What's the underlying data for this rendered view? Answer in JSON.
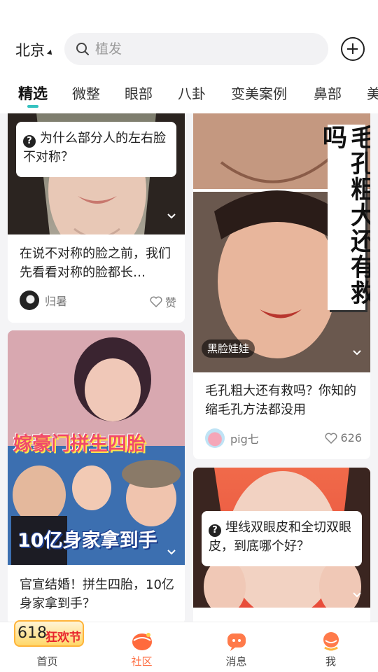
{
  "header": {
    "city": "北京",
    "search_placeholder": "植发",
    "add_icon": "plus-circle-icon"
  },
  "tabs": [
    {
      "label": "精选",
      "active": true
    },
    {
      "label": "微整"
    },
    {
      "label": "眼部"
    },
    {
      "label": "八卦"
    },
    {
      "label": "变美案例"
    },
    {
      "label": "鼻部"
    },
    {
      "label": "美"
    }
  ],
  "feed": {
    "left": [
      {
        "question": "为什么部分人的左右脸不对称？",
        "title": "在说不对称的脸之前，我们先看看对称的脸都长…",
        "author": "归暑",
        "likes": "赞"
      },
      {
        "image_title": "嫁豪门拼生四胎",
        "image_caption": "10亿身家拿到手",
        "title": "官宣结婚！拼生四胎，10亿身家拿到手？"
      }
    ],
    "right": [
      {
        "vertical_caption": "毛孔粗大还有救吗",
        "tag": "黑脸娃娃",
        "title": "毛孔粗大还有救吗？你知的缩毛孔方法都没用",
        "author": "pig七",
        "likes": "626"
      },
      {
        "question": "埋线双眼皮和全切双眼皮，到底哪个好？"
      }
    ]
  },
  "promo": {
    "number": "618",
    "text": "狂欢节"
  },
  "bottom_nav": [
    {
      "label": "首页",
      "icon": "home-icon"
    },
    {
      "label": "社区",
      "icon": "community-icon",
      "active": true
    },
    {
      "label": "消息",
      "icon": "message-icon"
    },
    {
      "label": "我",
      "icon": "profile-icon"
    }
  ],
  "colors": {
    "accent": "#36c2c0",
    "active_nav": "#ff6a3d"
  }
}
